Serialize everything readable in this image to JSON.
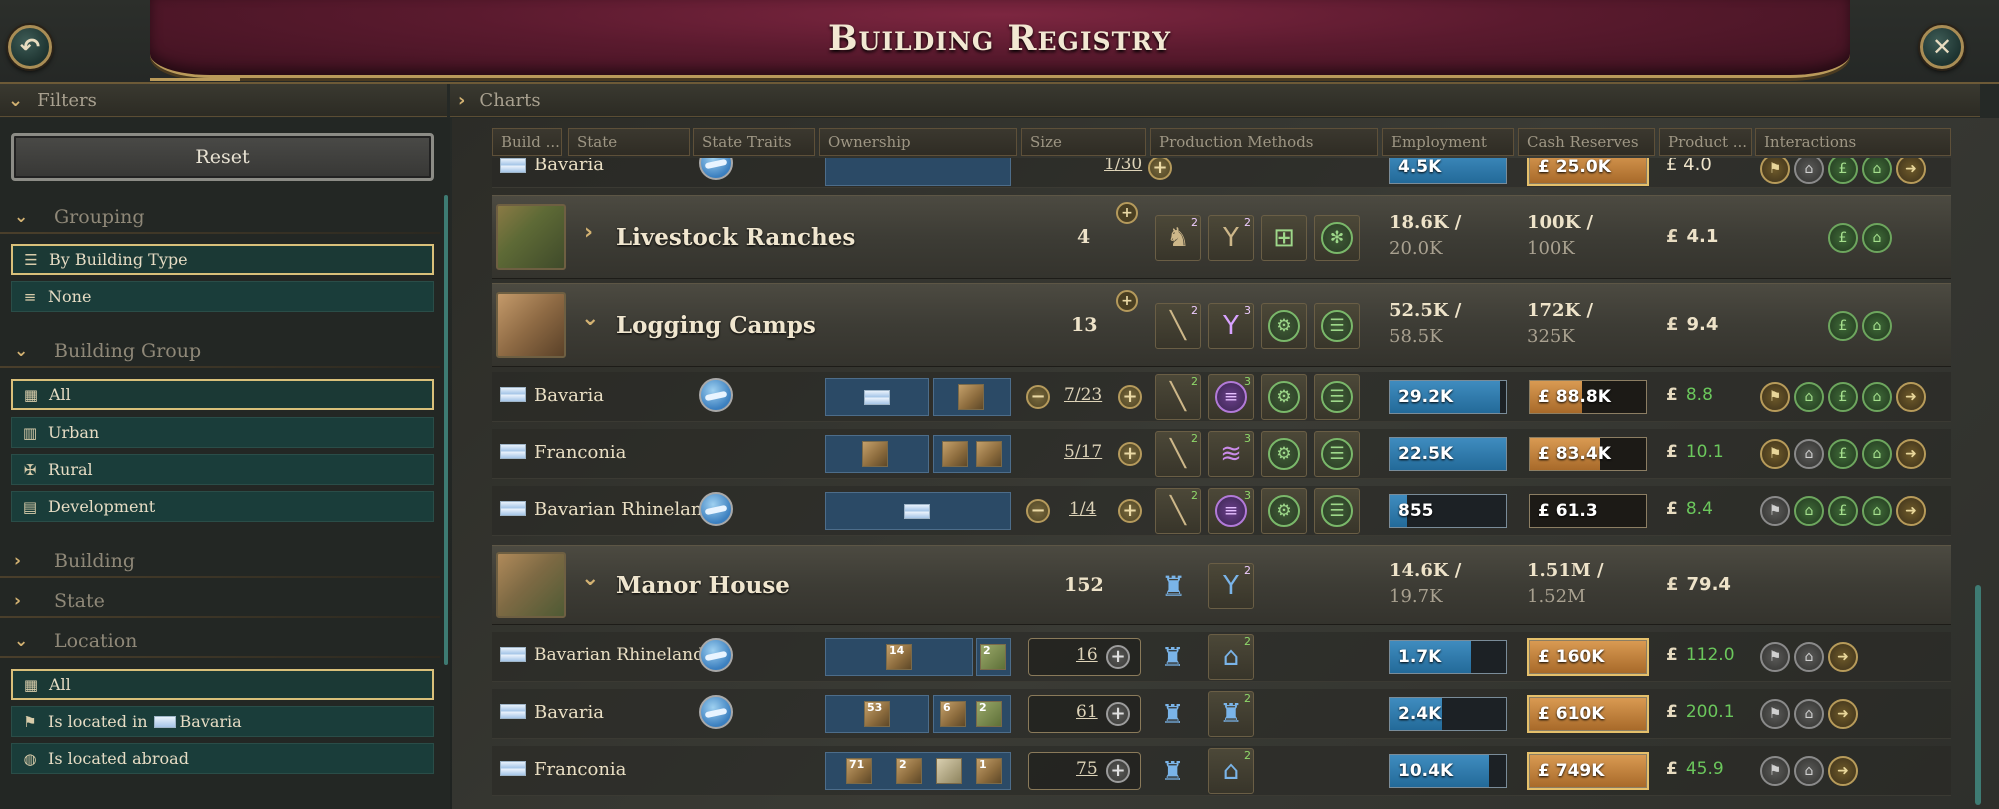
{
  "window": {
    "title": "Building Registry"
  },
  "sections": {
    "filters": "Filters",
    "charts": "Charts"
  },
  "filters": {
    "reset": "Reset",
    "grouping": {
      "label": "Grouping",
      "options": [
        "By Building Type",
        "None"
      ]
    },
    "building_group": {
      "label": "Building Group",
      "options": [
        "All",
        "Urban",
        "Rural",
        "Development"
      ]
    },
    "building": {
      "label": "Building"
    },
    "state": {
      "label": "State"
    },
    "location": {
      "label": "Location",
      "options": [
        "All",
        "Is located in",
        "Is located abroad"
      ],
      "located_in_state": "Bavaria"
    }
  },
  "columns": [
    "Build ...",
    "State",
    "State Traits",
    "Ownership",
    "Size",
    "Production Methods",
    "Employment",
    "Cash Reserves",
    "Product ...",
    "Interactions"
  ],
  "rows": {
    "top_partial": {
      "state": "Bavaria",
      "size_cur": "1",
      "size_max": "30",
      "employment": "4.5K",
      "cash": "£ 25.0K",
      "product": "£ 4.0",
      "product_value": "4.0"
    },
    "livestock": {
      "name": "Livestock Ranches",
      "count": "4",
      "emp1": "18.6K /",
      "emp2": "20.0K",
      "cash1": "100K /",
      "cash2": "100K",
      "product": "4.1"
    },
    "logging": {
      "name": "Logging Camps",
      "count": "13",
      "emp1": "52.5K /",
      "emp2": "58.5K",
      "cash1": "172K /",
      "cash2": "325K",
      "product": "9.4"
    },
    "log_bavaria": {
      "state": "Bavaria",
      "size_cur": "7",
      "size_max": "23",
      "employment": "29.2K",
      "emp_frac": 0.95,
      "cash": "£ 88.8K",
      "cash_frac": 0.45,
      "product": "8.8"
    },
    "log_franconia": {
      "state": "Franconia",
      "size_cur": "5",
      "size_max": "17",
      "employment": "22.5K",
      "emp_frac": 1.0,
      "cash": "£ 83.4K",
      "cash_frac": 0.6,
      "product": "10.1"
    },
    "log_rhineland": {
      "state": "Bavarian Rhineland",
      "size_cur": "1",
      "size_max": "4",
      "employment": "855",
      "emp_frac": 0.15,
      "cash": "£ 61.3",
      "cash_frac": 0.0,
      "product": "8.4"
    },
    "manor": {
      "name": "Manor House",
      "count": "152",
      "emp1": "14.6K /",
      "emp2": "19.7K",
      "cash1": "1.51M /",
      "cash2": "1.52M",
      "product": "79.4"
    },
    "manor_rhineland": {
      "state": "Bavarian Rhineland",
      "size": "16",
      "employment": "1.7K",
      "emp_frac": 0.7,
      "cash": "£ 160K",
      "cash_frac": 1.0,
      "product": "112.0",
      "own1": "14",
      "own2": "2"
    },
    "manor_bavaria": {
      "state": "Bavaria",
      "size": "61",
      "employment": "2.4K",
      "emp_frac": 0.45,
      "cash": "£ 610K",
      "cash_frac": 1.0,
      "product": "200.1",
      "own1": "53",
      "own2": "6",
      "own3": "2"
    },
    "manor_franconia": {
      "state": "Franconia",
      "size": "75",
      "employment": "10.4K",
      "emp_frac": 0.85,
      "cash": "£ 749K",
      "cash_frac": 1.0,
      "product": "45.9",
      "own1": "71",
      "own2": "2",
      "own3": "1"
    }
  },
  "currency": "£",
  "colors": {
    "accent_gold": "#d9c07a",
    "employment_blue": "#2f7fb3",
    "cash_orange": "#c78440",
    "positive_green": "#6bc75c",
    "banner_crimson": "#6b1f36"
  }
}
